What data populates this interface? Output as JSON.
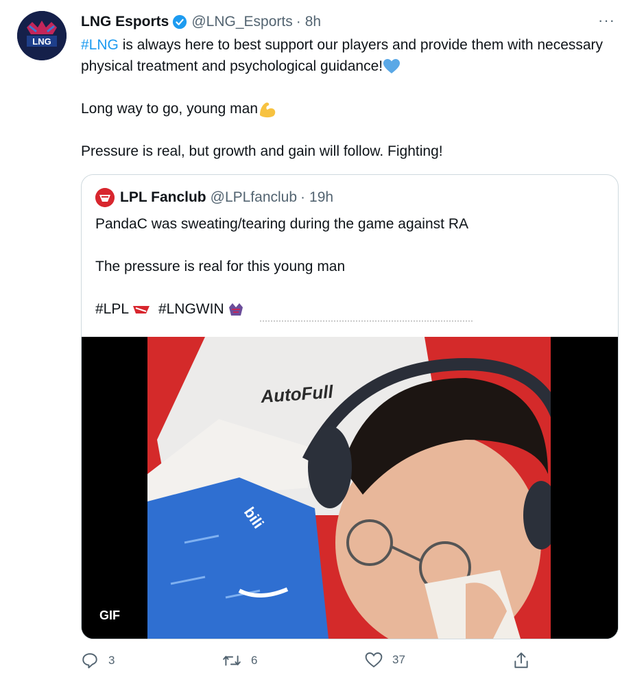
{
  "tweet": {
    "author_name": "LNG Esports",
    "handle": "@LNG_Esports",
    "separator": "·",
    "time": "8h",
    "hashtag": "#LNG",
    "line1_rest": " is always here to best support our players and provide them with necessary physical treatment and psychological guidance!",
    "line2": "Long way to go, young man",
    "line3": "Pressure is real, but growth and gain will follow. Fighting!",
    "more_label": "···",
    "avatar_text": "LNG"
  },
  "quoted": {
    "author_name": "LPL Fanclub",
    "handle": "@LPLfanclub",
    "separator": "·",
    "time": "19h",
    "text1": "PandaC was sweating/tearing during the game against RA",
    "text2": "The pressure is real for this young man",
    "tag1": "#LPL",
    "tag2": "#LNGWIN",
    "media_badge": "GIF",
    "chair_text": "AutoFull"
  },
  "actions": {
    "replies": "3",
    "retweets": "6",
    "likes": "37"
  },
  "colors": {
    "link": "#1d9bf0",
    "secondary": "#536471",
    "border": "#cfd9de"
  }
}
